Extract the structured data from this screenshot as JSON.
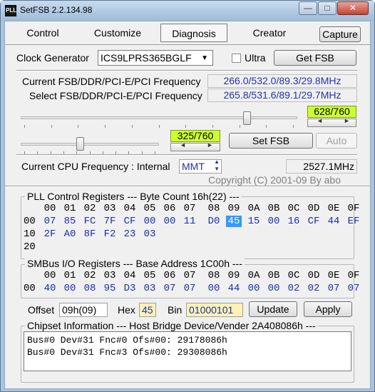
{
  "window": {
    "title": "SetFSB 2.2.134.98",
    "icon_text": "PLL",
    "minimize_glyph": "—",
    "maximize_glyph": "□",
    "close_glyph": "✕"
  },
  "tabs": [
    {
      "label": "Control"
    },
    {
      "label": "Customize"
    },
    {
      "label": "Diagnosis"
    },
    {
      "label": "Creator"
    }
  ],
  "capture_label": "Capture",
  "clock_generator": {
    "label": "Clock Generator",
    "value": "ICS9LPRS365BGLF",
    "ultra_label": "Ultra",
    "ultra_checked": false,
    "get_fsb_label": "Get FSB"
  },
  "frequencies": {
    "current_label": "Current FSB/DDR/PCI-E/PCI Frequency",
    "current_value": "266.0/532.0/89.3/29.8MHz",
    "select_label": "Select FSB/DDR/PCI-E/PCI Frequency",
    "select_value": "265.8/531.6/89.1/29.7MHz"
  },
  "slider_fsb": {
    "position": 628,
    "max": 760,
    "display": "628/760"
  },
  "slider_pcie": {
    "position": 325,
    "max": 760,
    "display": "325/760"
  },
  "set_fsb_label": "Set FSB",
  "auto_label": "Auto",
  "cpu_freq": {
    "label": "Current CPU Frequency : Internal",
    "mode": "MMT",
    "value": "2527.1MHz"
  },
  "copyright": "Copyright (C) 2001-09 By abo",
  "pll": {
    "title": "PLL Control Registers  --- Byte Count 16h(22) ---",
    "headers": [
      "00",
      "01",
      "02",
      "03",
      "04",
      "05",
      "06",
      "07",
      "08",
      "09",
      "0A",
      "0B",
      "0C",
      "0D",
      "0E",
      "0F"
    ],
    "rows": [
      {
        "label": "00",
        "values": [
          "07",
          "85",
          "FC",
          "7F",
          "CF",
          "00",
          "00",
          "11",
          "D0",
          "45",
          "15",
          "00",
          "16",
          "CF",
          "44",
          "EF"
        ]
      },
      {
        "label": "10",
        "values": [
          "2F",
          "A0",
          "8F",
          "F2",
          "23",
          "03"
        ]
      },
      {
        "label": "20",
        "values": []
      }
    ],
    "selected": "45"
  },
  "smbus": {
    "title": "SMBus I/O Registers  --- Base Address 1C00h ---",
    "headers": [
      "00",
      "01",
      "02",
      "03",
      "04",
      "05",
      "06",
      "07",
      "08",
      "09",
      "0A",
      "0B",
      "0C",
      "0D",
      "0E",
      "0F"
    ],
    "rows": [
      {
        "label": "00",
        "values": [
          "40",
          "00",
          "08",
          "95",
          "D3",
          "03",
          "07",
          "07",
          "00",
          "44",
          "00",
          "00",
          "02",
          "02",
          "07",
          "07"
        ]
      }
    ]
  },
  "offset": {
    "offset_label": "Offset",
    "offset_value": "09h(09)",
    "hex_label": "Hex",
    "hex_value": "45",
    "bin_label": "Bin",
    "bin_value": "01000101",
    "update_label": "Update",
    "apply_label": "Apply"
  },
  "chipset": {
    "title": "Chipset Information  --- Host Bridge Device/Vender 2A408086h ---",
    "lines": [
      "Bus#0 Dev#31 Fnc#0 Ofs#00: 29178086h",
      "Bus#0 Dev#31 Fnc#3 Ofs#00: 29308086h"
    ]
  },
  "colors": {
    "lcd_green": "#ccff33",
    "value_blue": "#1a2fb0",
    "highlight_yellow": "#fff2b3",
    "selection_blue": "#3399ff"
  }
}
